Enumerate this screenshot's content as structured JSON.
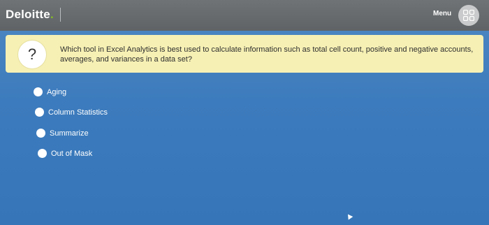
{
  "header": {
    "brand_name": "Deloitte",
    "brand_dot": ".",
    "menu_label": "Menu",
    "menu_icon": "grid-four-squares-icon"
  },
  "question": {
    "icon_glyph": "?",
    "text": "Which tool in Excel Analytics is best used to calculate information such as total cell count, positive and negative accounts, averages, and variances in a data set?"
  },
  "options": [
    {
      "label": "Aging"
    },
    {
      "label": "Column Statistics"
    },
    {
      "label": "Summarize"
    },
    {
      "label": "Out of Mask"
    }
  ],
  "colors": {
    "brand_accent": "#86bc25",
    "question_bg": "#f6f0b4",
    "content_bg": "#3c7bbd",
    "topbar_bg": "#65696b"
  }
}
